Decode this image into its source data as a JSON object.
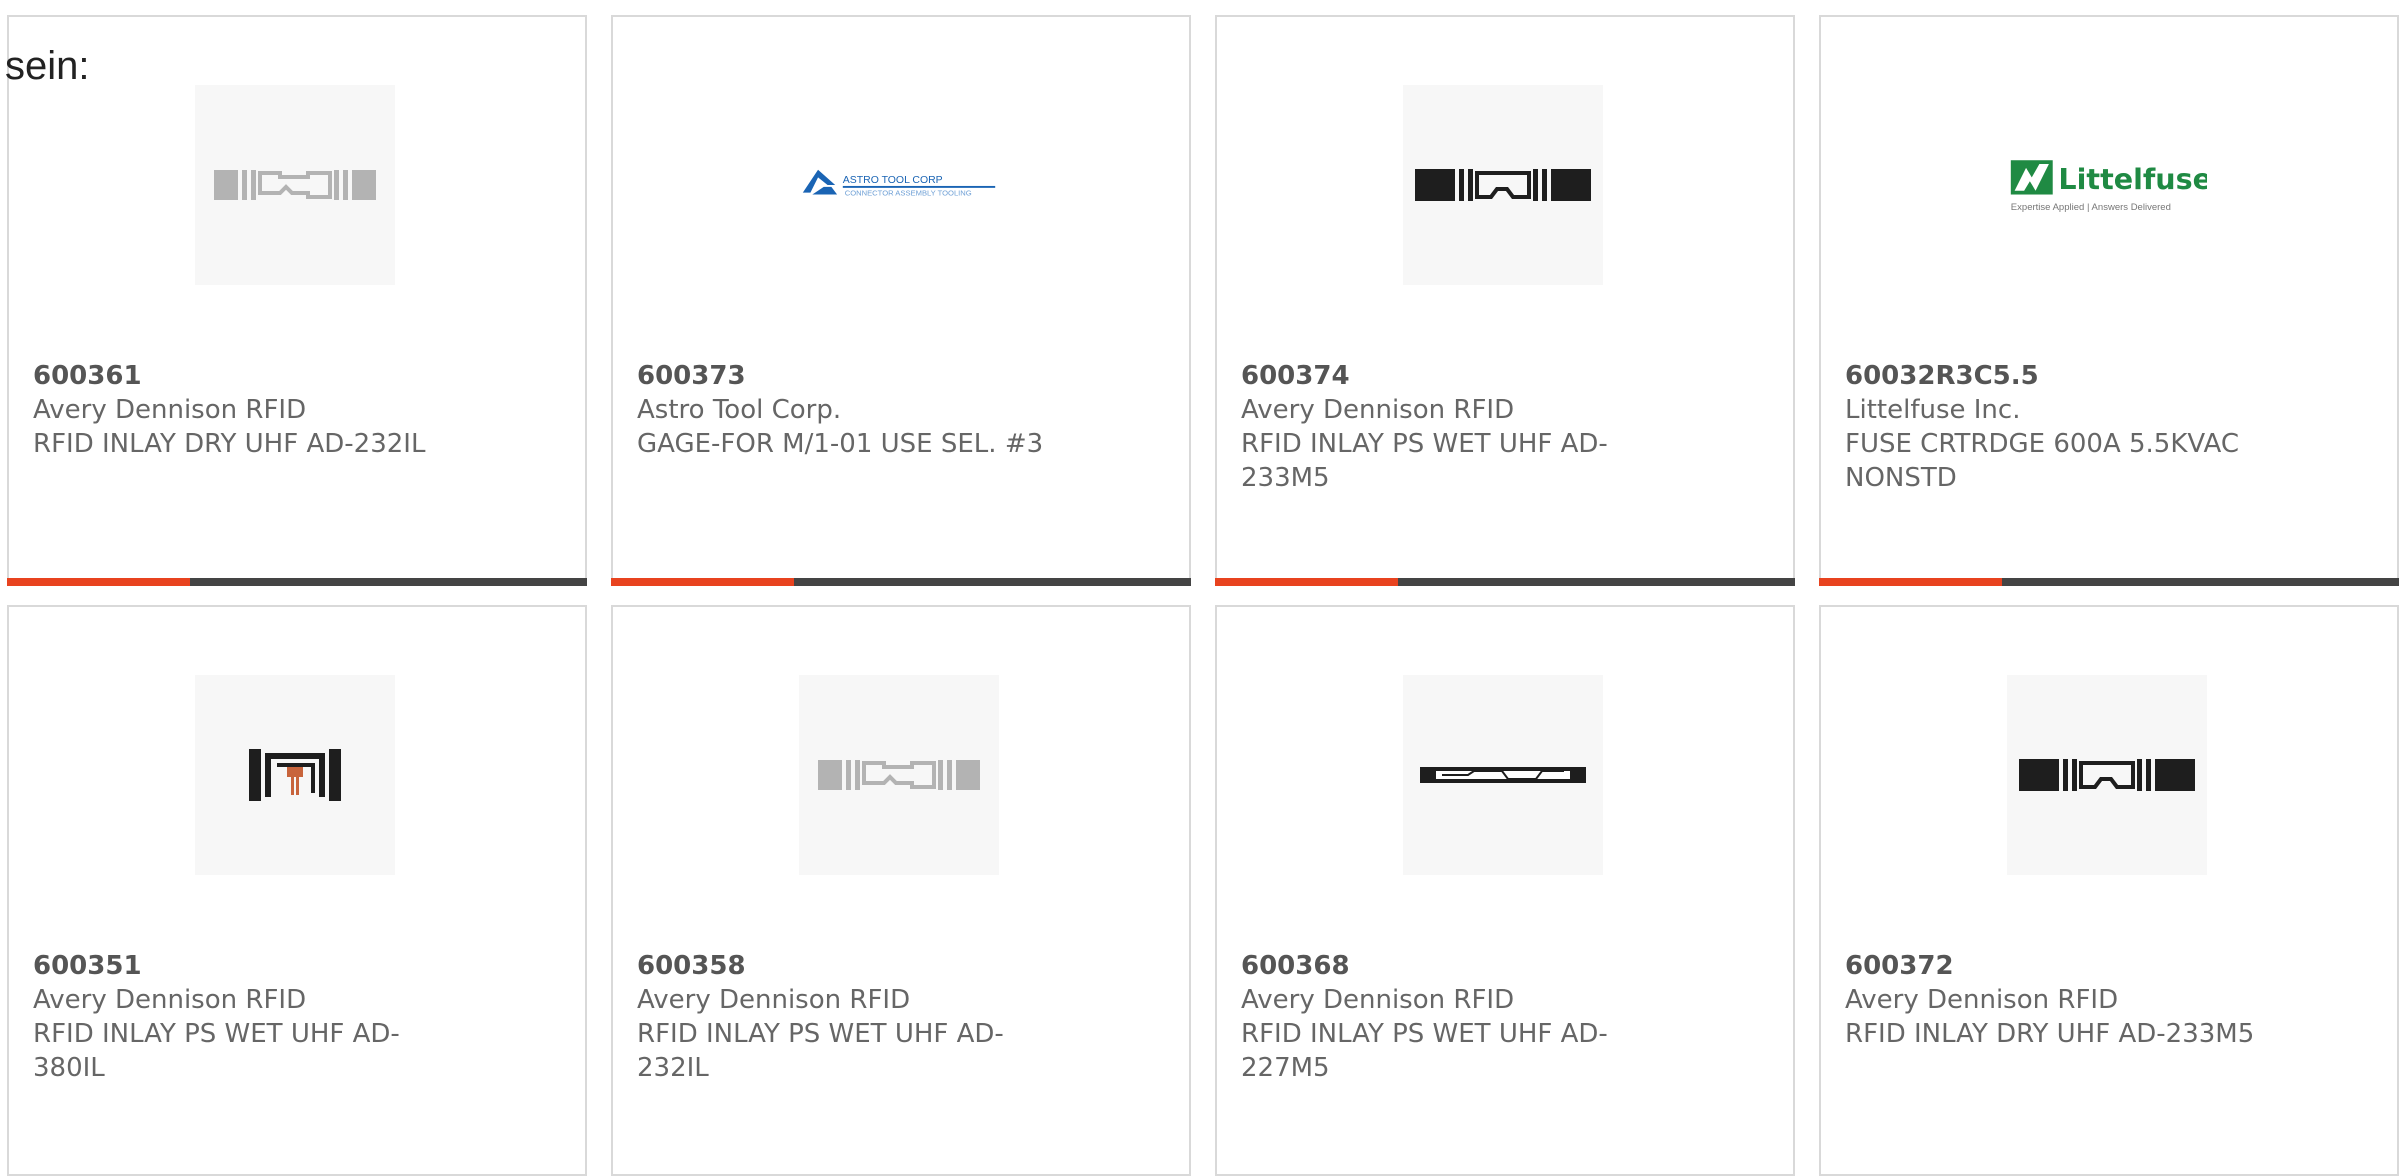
{
  "header": {
    "prefix_text": "sein:"
  },
  "colors": {
    "accent": "#e8431f",
    "bar": "#444444",
    "card_border": "#d9d9d9",
    "text": "#666666",
    "astro_blue": "#1a64b4",
    "littelfuse_green": "#1f8a43"
  },
  "products": [
    {
      "part_number": "600361",
      "manufacturer": "Avery Dennison RFID",
      "description": "RFID INLAY DRY UHF AD-232IL",
      "image": "rfid-inlay-gray-icon"
    },
    {
      "part_number": "600373",
      "manufacturer": "Astro Tool Corp.",
      "description": "GAGE-FOR M/1-01 USE SEL. #3",
      "image": "astro-tool-corp-logo",
      "logo_text": "ASTRO TOOL CORP",
      "logo_subtext": "CONNECTOR ASSEMBLY TOOLING"
    },
    {
      "part_number": "600374",
      "manufacturer": "Avery Dennison RFID",
      "description": "RFID INLAY PS WET UHF AD-233M5",
      "image": "rfid-inlay-black-icon"
    },
    {
      "part_number": "60032R3C5.5",
      "manufacturer": "Littelfuse Inc.",
      "description": "FUSE CRTRDGE 600A 5.5KVAC NONSTD",
      "image": "littelfuse-logo",
      "logo_text": "Littelfuse",
      "logo_subtext": "Expertise Applied | Answers Delivered"
    },
    {
      "part_number": "600351",
      "manufacturer": "Avery Dennison RFID",
      "description": "RFID INLAY PS WET UHF AD-380IL",
      "image": "rfid-inlay-compact-icon"
    },
    {
      "part_number": "600358",
      "manufacturer": "Avery Dennison RFID",
      "description": "RFID INLAY PS WET UHF AD-232IL",
      "image": "rfid-inlay-gray-icon"
    },
    {
      "part_number": "600368",
      "manufacturer": "Avery Dennison RFID",
      "description": "RFID INLAY PS WET UHF AD-227M5",
      "image": "rfid-inlay-slim-icon"
    },
    {
      "part_number": "600372",
      "manufacturer": "Avery Dennison RFID",
      "description": "RFID INLAY DRY UHF AD-233M5",
      "image": "rfid-inlay-black-icon"
    }
  ]
}
